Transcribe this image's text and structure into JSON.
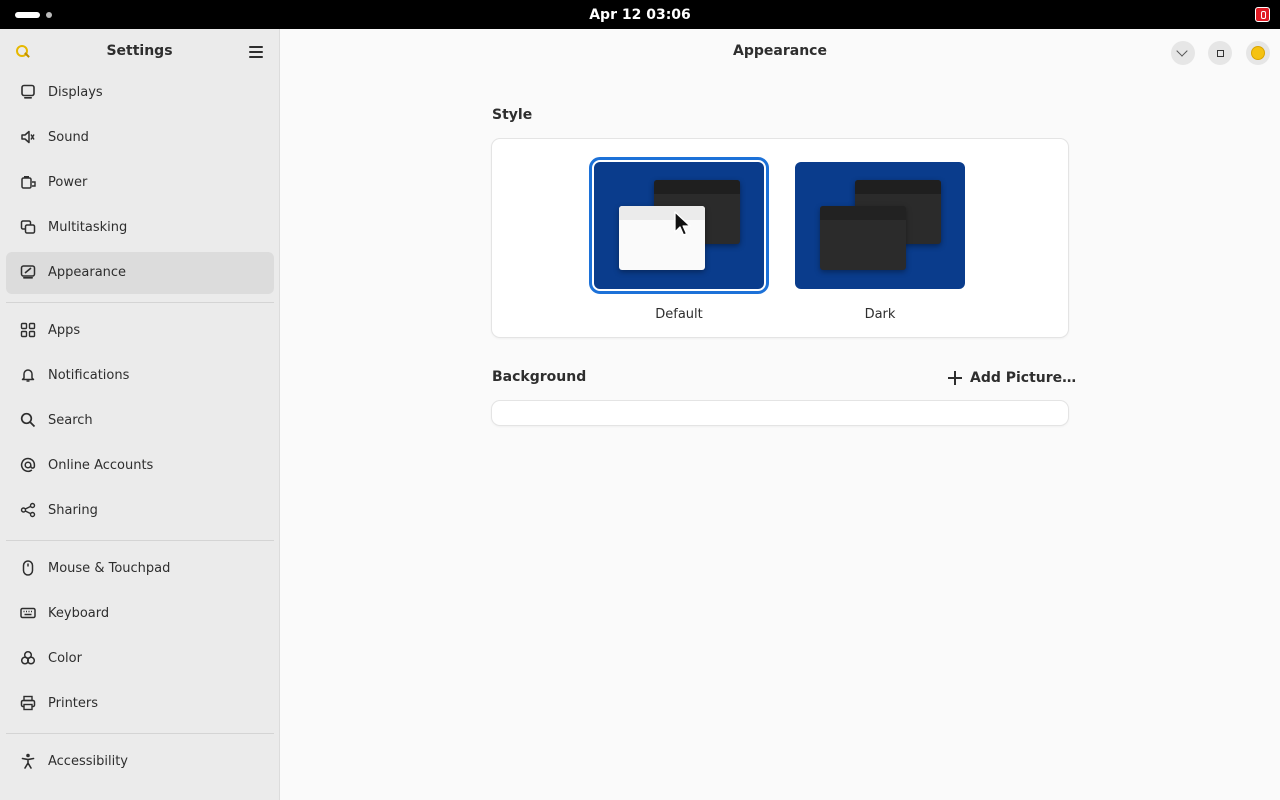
{
  "topbar": {
    "clock": "Apr 12  03:06"
  },
  "sidebar": {
    "title": "Settings",
    "items": [
      {
        "label": "Displays",
        "icon": "display-icon"
      },
      {
        "label": "Sound",
        "icon": "speaker-icon"
      },
      {
        "label": "Power",
        "icon": "battery-icon"
      },
      {
        "label": "Multitasking",
        "icon": "multitasking-icon"
      },
      {
        "label": "Appearance",
        "icon": "appearance-icon",
        "active": true
      },
      {
        "label": "Apps",
        "icon": "apps-grid-icon"
      },
      {
        "label": "Notifications",
        "icon": "bell-icon"
      },
      {
        "label": "Search",
        "icon": "search-icon"
      },
      {
        "label": "Online Accounts",
        "icon": "at-sign-icon"
      },
      {
        "label": "Sharing",
        "icon": "share-icon"
      },
      {
        "label": "Mouse & Touchpad",
        "icon": "mouse-icon"
      },
      {
        "label": "Keyboard",
        "icon": "keyboard-icon"
      },
      {
        "label": "Color",
        "icon": "color-icon"
      },
      {
        "label": "Printers",
        "icon": "printer-icon"
      },
      {
        "label": "Accessibility",
        "icon": "accessibility-icon"
      }
    ]
  },
  "content": {
    "title": "Appearance",
    "style": {
      "heading": "Style",
      "options": [
        {
          "label": "Default",
          "selected": true
        },
        {
          "label": "Dark",
          "selected": false
        }
      ]
    },
    "background": {
      "heading": "Background",
      "add_picture": "Add Picture…"
    }
  },
  "colors": {
    "accent": "#1c71d8",
    "wallpaper_preview": "#0a3c8c",
    "sidebar_bg": "#ebebeb",
    "content_bg": "#fafafa"
  }
}
